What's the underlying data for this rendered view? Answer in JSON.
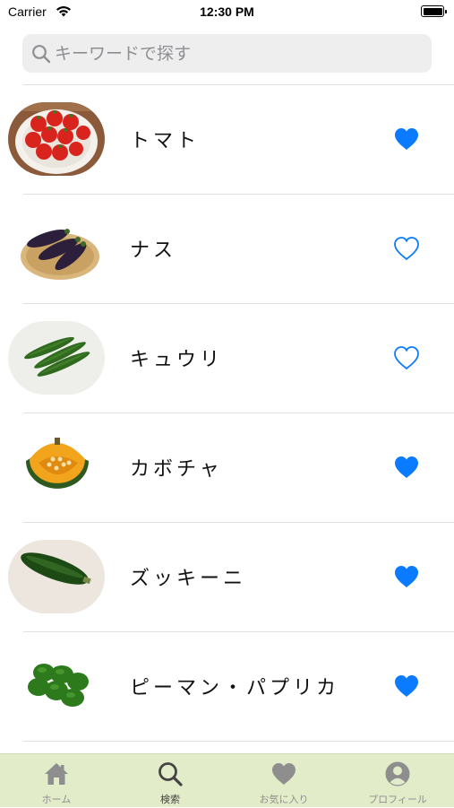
{
  "status_bar": {
    "carrier": "Carrier",
    "time": "12:30 PM"
  },
  "search": {
    "placeholder": "キーワードで探す",
    "value": ""
  },
  "items": [
    {
      "name": "トマト",
      "favorite": true,
      "image": "tomato-image"
    },
    {
      "name": "ナス",
      "favorite": false,
      "image": "eggplant-image"
    },
    {
      "name": "キュウリ",
      "favorite": false,
      "image": "cucumber-image"
    },
    {
      "name": "カボチャ",
      "favorite": true,
      "image": "pumpkin-image"
    },
    {
      "name": "ズッキーニ",
      "favorite": true,
      "image": "zucchini-image"
    },
    {
      "name": "ピーマン・パプリカ",
      "favorite": true,
      "image": "green-pepper-image"
    }
  ],
  "tabs": [
    {
      "label": "ホーム",
      "icon": "home-icon",
      "active": false
    },
    {
      "label": "検索",
      "icon": "search-icon",
      "active": true
    },
    {
      "label": "お気に入り",
      "icon": "heart-icon",
      "active": false
    },
    {
      "label": "プロフィール",
      "icon": "profile-icon",
      "active": false
    }
  ],
  "colors": {
    "accent": "#0a7aff",
    "tab_bar_background": "#e3ecc9",
    "tab_inactive": "#8e8e8e",
    "tab_active": "#444444"
  }
}
